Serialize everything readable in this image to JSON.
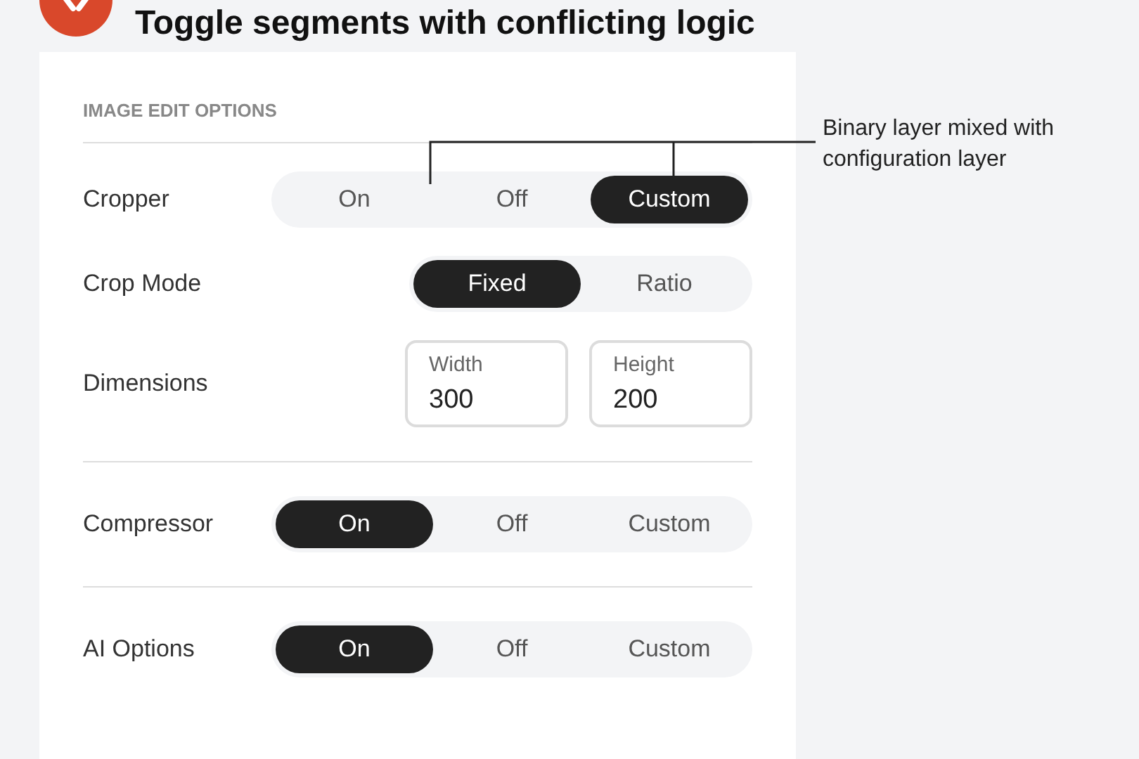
{
  "header": {
    "title": "Toggle segments with conflicting logic"
  },
  "panel": {
    "heading": "IMAGE EDIT OPTIONS"
  },
  "annotation": {
    "text": "Binary layer mixed with configuration layer"
  },
  "rows": [
    {
      "kind": "segments",
      "label": "Cropper",
      "options": [
        {
          "label": "On",
          "selected": false
        },
        {
          "label": "Off",
          "selected": false
        },
        {
          "label": "Custom",
          "selected": true
        }
      ]
    },
    {
      "kind": "segments",
      "label": "Crop Mode",
      "options": [
        {
          "label": "Fixed",
          "selected": true
        },
        {
          "label": "Ratio",
          "selected": false
        }
      ]
    },
    {
      "kind": "fields",
      "label": "Dimensions",
      "fields": [
        {
          "label": "Width",
          "value": "300"
        },
        {
          "label": "Height",
          "value": "200"
        }
      ]
    },
    {
      "kind": "divider"
    },
    {
      "kind": "segments",
      "label": "Compressor",
      "options": [
        {
          "label": "On",
          "selected": true
        },
        {
          "label": "Off",
          "selected": false
        },
        {
          "label": "Custom",
          "selected": false
        }
      ]
    },
    {
      "kind": "divider"
    },
    {
      "kind": "segments",
      "label": "AI Options",
      "options": [
        {
          "label": "On",
          "selected": true
        },
        {
          "label": "Off",
          "selected": false
        },
        {
          "label": "Custom",
          "selected": false
        }
      ]
    }
  ]
}
